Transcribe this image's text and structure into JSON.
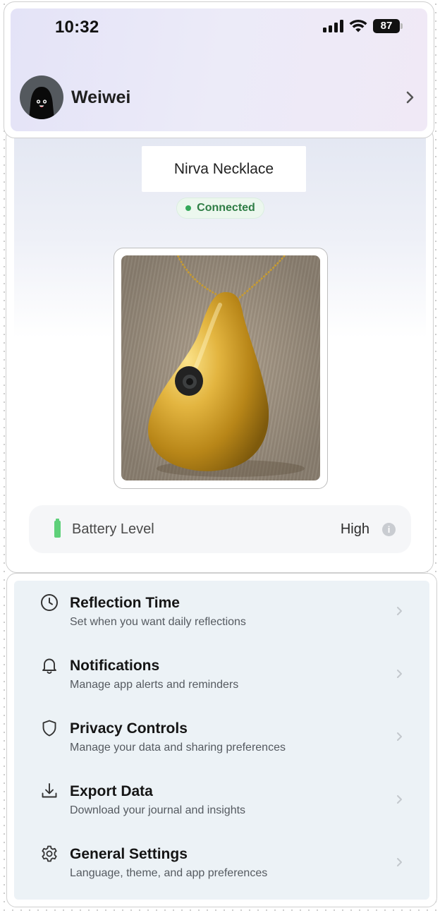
{
  "status_bar": {
    "time": "10:32",
    "battery_percent": "87",
    "signal_icon": "cellular-signal-icon",
    "wifi_icon": "wifi-icon"
  },
  "profile": {
    "name": "Weiwei",
    "avatar_icon": "ghost-avatar",
    "chevron_icon": "chevron-right-icon"
  },
  "device": {
    "name": "Nirva Necklace",
    "status": "Connected",
    "status_color": "#2f7d45",
    "image_icon": "gold-teardrop-pendant-photo"
  },
  "battery": {
    "label": "Battery Level",
    "value": "High",
    "icon": "battery-icon",
    "info_icon": "info-icon",
    "info_glyph": "i",
    "color": "#5fd07a"
  },
  "settings": {
    "items": [
      {
        "icon": "clock-icon",
        "title": "Reflection Time",
        "subtitle": "Set when you want daily reflections"
      },
      {
        "icon": "bell-icon",
        "title": "Notifications",
        "subtitle": "Manage app alerts and reminders"
      },
      {
        "icon": "shield-icon",
        "title": "Privacy Controls",
        "subtitle": "Manage your data and sharing preferences"
      },
      {
        "icon": "download-icon",
        "title": "Export Data",
        "subtitle": "Download your journal and insights"
      },
      {
        "icon": "gear-icon",
        "title": "General Settings",
        "subtitle": "Language, theme, and app preferences"
      }
    ]
  }
}
